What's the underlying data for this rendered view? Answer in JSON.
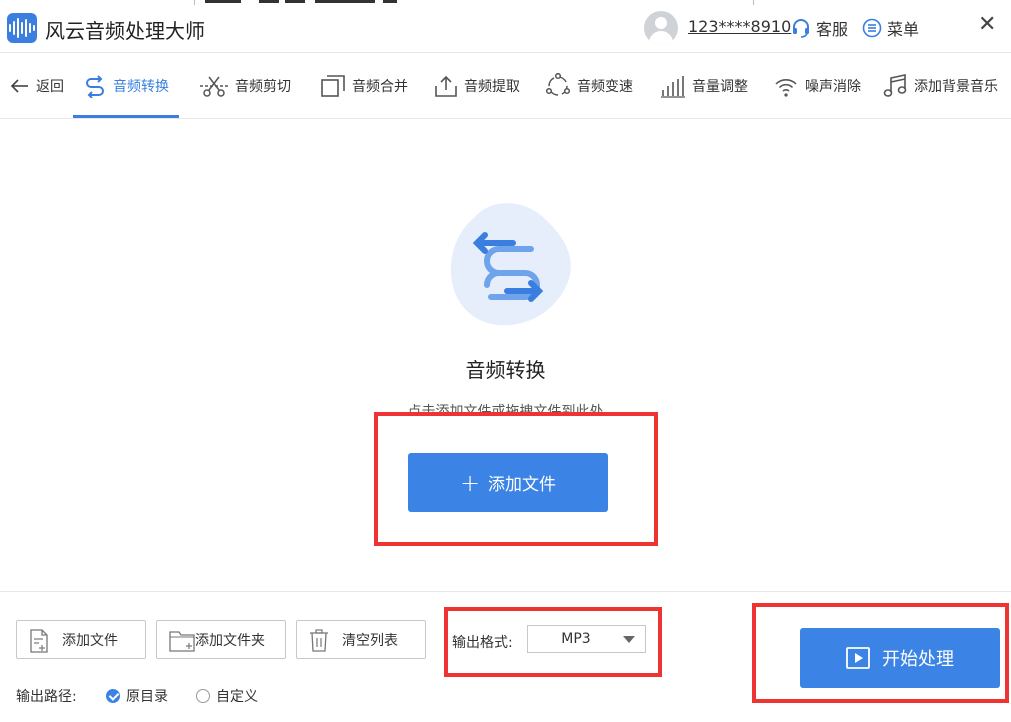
{
  "app": {
    "title": "风云音频处理大师",
    "user_phone": "123****8910",
    "support_label": "客服",
    "menu_label": "菜单",
    "close_glyph": "✕"
  },
  "toolbar": {
    "back_label": "返回",
    "tabs": [
      {
        "label": "音频转换",
        "icon": "convert-arrows-icon",
        "active": true
      },
      {
        "label": "音频剪切",
        "icon": "scissors-icon"
      },
      {
        "label": "音频合并",
        "icon": "merge-squares-icon"
      },
      {
        "label": "音频提取",
        "icon": "upload-tray-icon"
      },
      {
        "label": "音频变速",
        "icon": "speed-circle-icon"
      },
      {
        "label": "音量调整",
        "icon": "volume-bars-icon"
      },
      {
        "label": "噪声消除",
        "icon": "wifi-signal-icon"
      },
      {
        "label": "添加背景音乐",
        "icon": "music-note-icon"
      }
    ]
  },
  "main": {
    "title": "音频转换",
    "hint": "点击添加文件或拖拽文件到此处",
    "add_file_label": "添加文件",
    "plus_glyph": "+"
  },
  "bottom": {
    "add_file_label": "添加文件",
    "add_folder_label": "添加文件夹",
    "clear_list_label": "清空列表",
    "format_label": "输出格式:",
    "format_value": "MP3",
    "start_label": "开始处理",
    "output_path_label": "输出路径:",
    "radio_original": "原目录",
    "radio_custom": "自定义"
  },
  "colors": {
    "accent": "#3b84e6",
    "highlight_red": "#ee3333"
  }
}
